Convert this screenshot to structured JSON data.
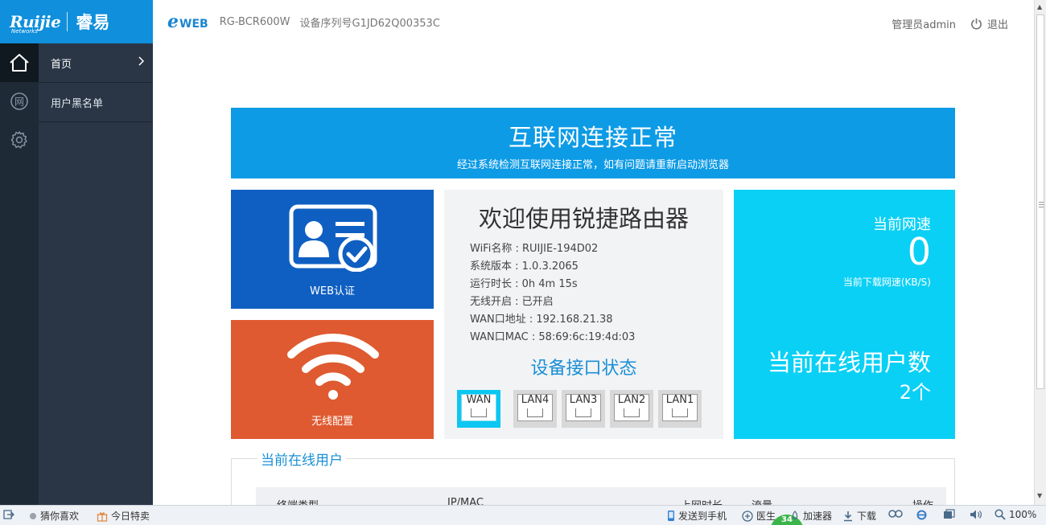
{
  "brand": {
    "logo_text": "Ruijie",
    "logo_sub": "Networks",
    "logo_cn": "睿易"
  },
  "header": {
    "eweb_e": "e",
    "eweb_text": "WEB",
    "model": "RG-BCR600W",
    "serial": "设备序列号G1JD62Q00353C",
    "admin": "管理员admin",
    "logout": "退出"
  },
  "rail": {
    "icons": [
      "home-icon",
      "network-icon",
      "gear-icon"
    ],
    "network_glyph": "网"
  },
  "sidebar": {
    "items": [
      {
        "label": "首页",
        "active": true
      },
      {
        "label": "用户黑名单",
        "active": false
      }
    ]
  },
  "banner": {
    "title": "互联网连接正常",
    "subtitle": "经过系统检测互联网连接正常，如有问题请重新启动浏览器"
  },
  "tiles": {
    "web_auth": "WEB认证",
    "wifi_config": "无线配置"
  },
  "info": {
    "title": "欢迎使用锐捷路由器",
    "lines": [
      "WiFi名称 : RUIJIE-194D02",
      "系统版本 : 1.0.3.2065",
      "运行时长 : 0h 4m 15s",
      "无线开启 : 已开启",
      "WAN口地址 : 192.168.21.38",
      "WAN口MAC : 58:69:6c:19:4d:03"
    ],
    "ports_title": "设备接口状态",
    "ports": [
      {
        "name": "WAN",
        "active": true
      },
      {
        "name": "LAN4",
        "active": false
      },
      {
        "name": "LAN3",
        "active": false
      },
      {
        "name": "LAN2",
        "active": false
      },
      {
        "name": "LAN1",
        "active": false
      }
    ]
  },
  "stats": {
    "speed_label": "当前网速",
    "speed_value": "0",
    "speed_unit": "当前下载网速(KB/S)",
    "online_label": "当前在线用户数",
    "online_count": "2个"
  },
  "online_users": {
    "title": "当前在线用户",
    "columns": [
      "终端类型",
      "IP/MAC",
      "上网时长",
      "流量",
      "操作"
    ]
  },
  "statusbar": {
    "guess": "猜你喜欢",
    "today_sale": "今日特卖",
    "send_phone": "发送到手机",
    "doctor": "医生",
    "badge": "34",
    "accelerator": "加速器",
    "download": "下载",
    "zoom": "100%"
  },
  "colors": {
    "brand_blue": "#0f8fdc",
    "banner_blue": "#0d9be6",
    "web_tile": "#0f5fc2",
    "wifi_tile": "#df5a30",
    "stats_cyan": "#0ad0f5",
    "sidebar_dark": "#2a3646"
  }
}
